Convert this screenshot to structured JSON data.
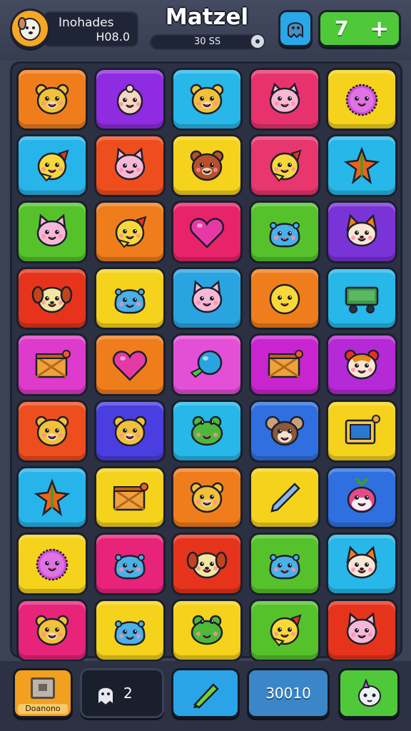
{
  "header": {
    "player_name": "Inohades",
    "player_score": "H08.0",
    "title": "Matzel",
    "sub_value": "30 SS",
    "level": "7",
    "add_symbol": "+"
  },
  "board": {
    "rows": 9,
    "cols": 5,
    "tiles": [
      {
        "bg": "#f07d1c",
        "icon": "bear-face-icon"
      },
      {
        "bg": "#8f2be0",
        "icon": "bunny-face-icon"
      },
      {
        "bg": "#27b7e8",
        "icon": "bear-face-icon"
      },
      {
        "bg": "#e8326e",
        "icon": "pig-face-icon"
      },
      {
        "bg": "#f5d21c",
        "icon": "fuzzy-ball-icon"
      },
      {
        "bg": "#27b4ea",
        "icon": "bird-face-icon"
      },
      {
        "bg": "#ee4e1e",
        "icon": "cat-face-icon"
      },
      {
        "bg": "#f5d21c",
        "icon": "bear-face-icon"
      },
      {
        "bg": "#e8366e",
        "icon": "bird-face-icon"
      },
      {
        "bg": "#27b7e8",
        "icon": "spiky-leaf-icon"
      },
      {
        "bg": "#55c22c",
        "icon": "cat-face-icon"
      },
      {
        "bg": "#f07d1c",
        "icon": "bird-face-icon"
      },
      {
        "bg": "#e8236a",
        "icon": "heart-icon"
      },
      {
        "bg": "#55c22c",
        "icon": "blob-face-icon"
      },
      {
        "bg": "#7a33d6",
        "icon": "fox-face-icon"
      },
      {
        "bg": "#e6341c",
        "icon": "dog-face-icon"
      },
      {
        "bg": "#f5d21c",
        "icon": "blob-face-icon"
      },
      {
        "bg": "#2aa4e0",
        "icon": "cat-face-icon"
      },
      {
        "bg": "#f07d1c",
        "icon": "round-face-icon"
      },
      {
        "bg": "#27b7e8",
        "icon": "cart-icon"
      },
      {
        "bg": "#de3acb",
        "icon": "crate-icon"
      },
      {
        "bg": "#f07d1c",
        "icon": "heart-icon"
      },
      {
        "bg": "#e34fd6",
        "icon": "candy-icon"
      },
      {
        "bg": "#c825d0",
        "icon": "crate-icon"
      },
      {
        "bg": "#b629d6",
        "icon": "hamster-face-icon"
      },
      {
        "bg": "#ee4e1e",
        "icon": "bear-face-icon"
      },
      {
        "bg": "#4b3ee0",
        "icon": "bear-face-icon"
      },
      {
        "bg": "#27b7e8",
        "icon": "frog-face-icon"
      },
      {
        "bg": "#2f6fe0",
        "icon": "mouse-face-icon"
      },
      {
        "bg": "#f5d21c",
        "icon": "tv-icon"
      },
      {
        "bg": "#27b4ea",
        "icon": "spiky-leaf-icon"
      },
      {
        "bg": "#f5d21c",
        "icon": "crate-icon"
      },
      {
        "bg": "#f07d1c",
        "icon": "bear-face-icon"
      },
      {
        "bg": "#f5d21c",
        "icon": "tool-icon"
      },
      {
        "bg": "#2f6fe0",
        "icon": "radish-face-icon"
      },
      {
        "bg": "#f5d21c",
        "icon": "fuzzy-ball-icon"
      },
      {
        "bg": "#e8237a",
        "icon": "blob-face-icon"
      },
      {
        "bg": "#e6341c",
        "icon": "dog-face-icon"
      },
      {
        "bg": "#55c22c",
        "icon": "blob-face-icon"
      },
      {
        "bg": "#27b7e8",
        "icon": "fox-face-icon"
      },
      {
        "bg": "#e8237a",
        "icon": "bear-face-icon"
      },
      {
        "bg": "#f5d21c",
        "icon": "blob-face-icon"
      },
      {
        "bg": "#f5d21c",
        "icon": "frog-face-icon"
      },
      {
        "bg": "#55c22c",
        "icon": "bird-face-icon"
      },
      {
        "bg": "#e6341c",
        "icon": "cat-face-icon"
      }
    ]
  },
  "footer": {
    "item_label": "Doanono",
    "item_count": "2",
    "score": "30010"
  }
}
